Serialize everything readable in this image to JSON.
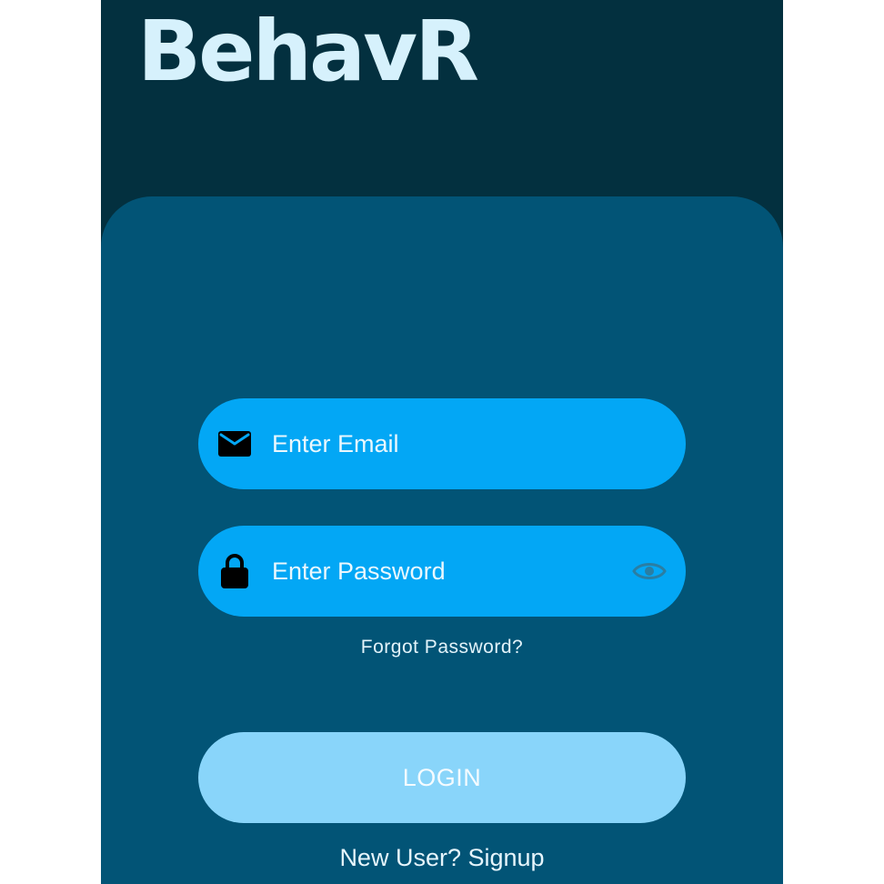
{
  "app": {
    "title": "BehavR"
  },
  "form": {
    "email": {
      "placeholder": "Enter Email",
      "icon": "mail-icon"
    },
    "password": {
      "placeholder": "Enter Password",
      "icon": "lock-icon",
      "toggle_icon": "eye-icon"
    },
    "forgot_password_label": "Forgot Password?",
    "login_label": "LOGIN",
    "signup_label": "New User? Signup"
  },
  "colors": {
    "header_bg": "#03303f",
    "card_bg": "#025476",
    "field_bg": "#03a7f5",
    "button_bg": "#89d5fa",
    "title_color": "#d6f1fc"
  }
}
